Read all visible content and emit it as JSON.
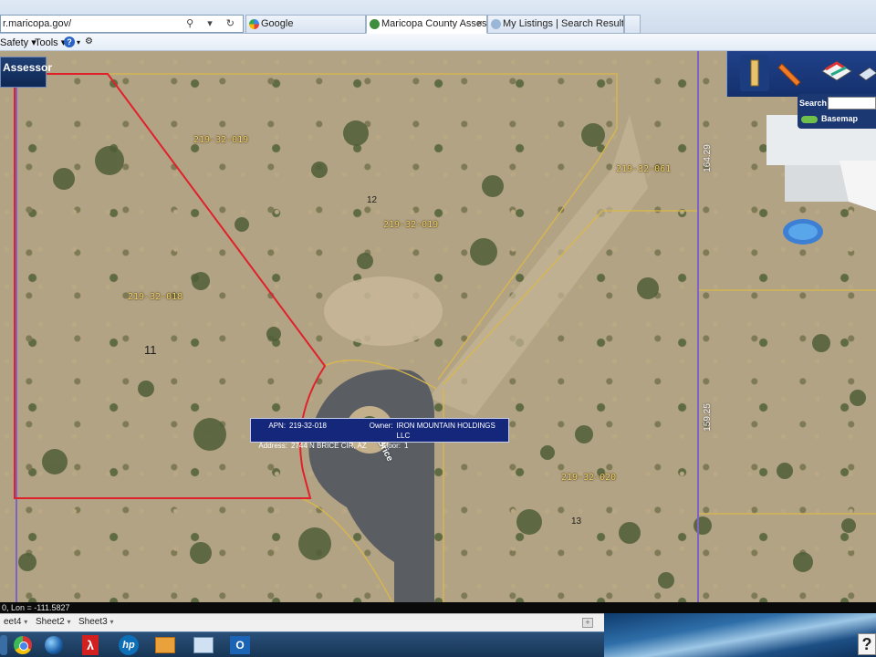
{
  "browser": {
    "address": "r.maricopa.gov/",
    "address_icons": "⚲ ▾ ↻",
    "tabs": [
      {
        "label": "Google",
        "active": false
      },
      {
        "label": "Maricopa County Assessor'...",
        "active": true
      },
      {
        "label": "My Listings | Search Results | fl...",
        "active": false
      }
    ],
    "tab_close": "×",
    "command_bar": {
      "safety": "Safety ▾",
      "tools": "Tools ▾",
      "help_icon": "?",
      "help_caret": "▾",
      "extra": "⚙"
    }
  },
  "map": {
    "badge": "Assessor",
    "toolbar_icons": [
      "ruler-icon",
      "pencil-icon",
      "layers-icon",
      "more-icon"
    ],
    "search_label": "Search",
    "search_value": "",
    "basemap_label": "Basemap",
    "parcel_labels": [
      "219-32-019",
      "219-32-019",
      "219-32-061",
      "219-32-018",
      "219-32-020"
    ],
    "lot_numbers": [
      "11",
      "12",
      "13"
    ],
    "road_label": "N Brice",
    "side_bearings": [
      "164.29",
      "159.25"
    ],
    "tooltip": {
      "apn_key": "APN:",
      "apn": "219-32-018",
      "owner_key": "Owner:",
      "owner": "IRON MOUNTAIN HOLDINGS LLC",
      "address_key": "Address:",
      "address": "2744 N BRICE CIR, AZ",
      "floor_key": "Floor:",
      "floor": "1"
    },
    "colors": {
      "selected_parcel": "#e0202a",
      "parcel_lines": "#d9b84a",
      "road": "#5a5e63"
    }
  },
  "status": {
    "coords": "0, Lon = -111.5827"
  },
  "spreadsheet": {
    "sheets": [
      "eet4",
      "Sheet2",
      "Sheet3"
    ],
    "caret": "▾",
    "add": "+"
  },
  "taskbar": {
    "apps": [
      "chrome-icon",
      "google-earth-icon",
      "acrobat-icon",
      "hp-icon",
      "toolbox-icon",
      "explorer-icon",
      "outlook-icon"
    ],
    "pdf_glyph": "λ",
    "hp_glyph": "hp",
    "outlook_glyph": "O",
    "help_glyph": "?"
  }
}
